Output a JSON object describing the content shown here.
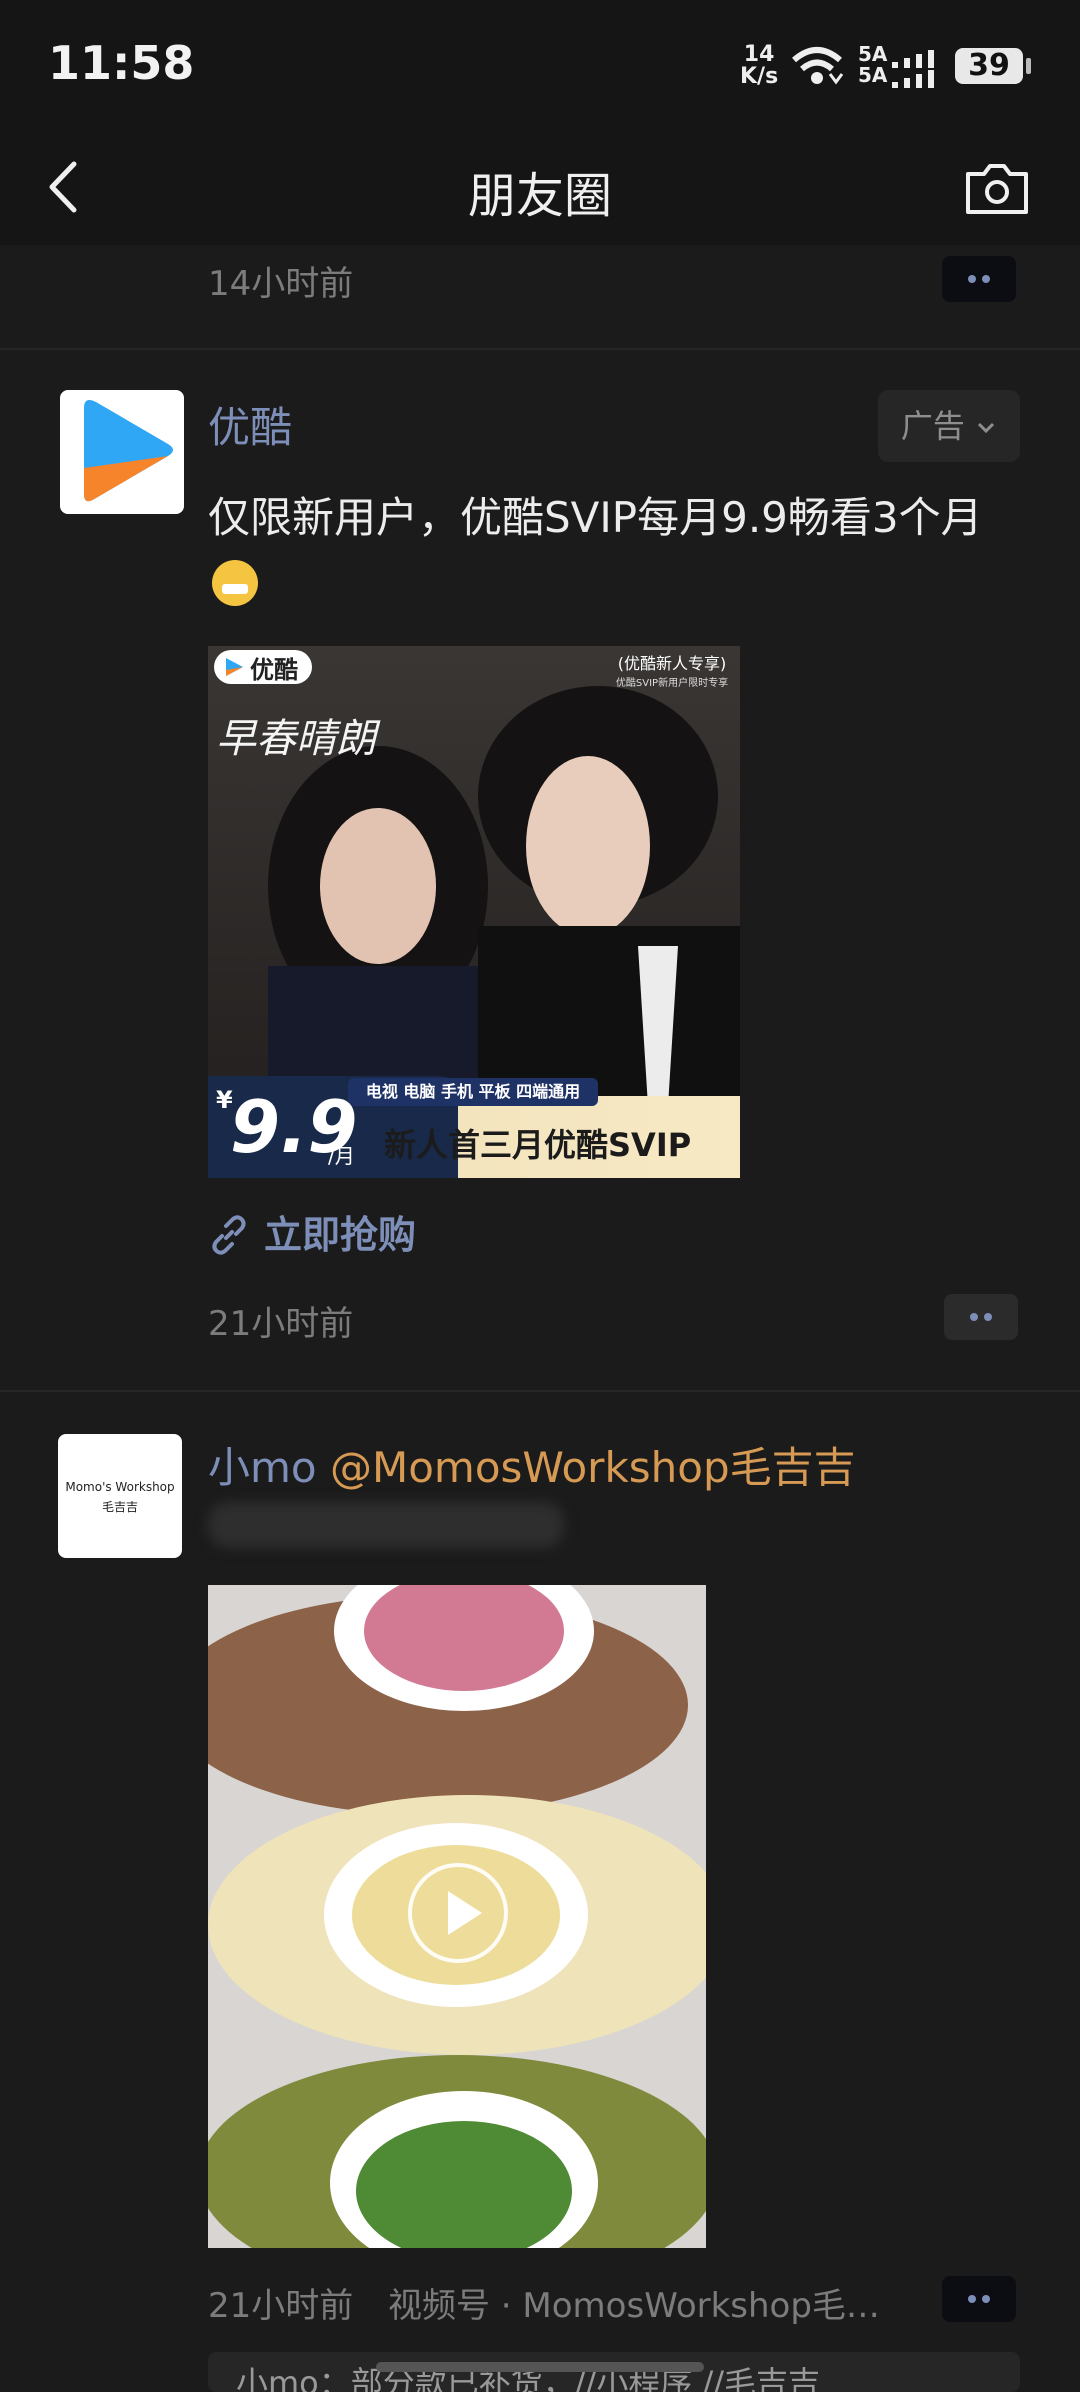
{
  "status_bar": {
    "time": "11:58",
    "net_speed_value": "14",
    "net_speed_unit": "K/s",
    "signal_1": "5A",
    "signal_2": "5A",
    "battery": "39"
  },
  "nav": {
    "title": "朋友圈"
  },
  "prev_post": {
    "timestamp": "14小时前"
  },
  "ad_post": {
    "author": "优酷",
    "ad_label": "广告",
    "text": "仅限新用户，优酷SVIP每月9.9畅看3个月",
    "image": {
      "brand": "优酷",
      "corner_title": "(优酷新人专享)",
      "corner_sub": "优酷SVIP新用户限时专享",
      "show_title": "早春晴朗",
      "currency": "¥",
      "price": "9.9",
      "price_unit": "/月",
      "devices": "电视 电脑 手机 平板 四端通用",
      "offer": "新人首三月优酷SVIP"
    },
    "link_label": "立即抢购",
    "timestamp": "21小时前"
  },
  "video_post": {
    "author": "小mo",
    "mention": "@MomosWorkshop毛吉吉",
    "avatar_line1": "Momo's Workshop",
    "avatar_line2": "毛吉吉",
    "timestamp": "21小时前",
    "source": "视频号 · MomosWorkshop毛…",
    "comment_preview": "小mo：部分款已补货，//小程序 //毛吉吉"
  },
  "colors": {
    "background": "#1b1b1b",
    "name_link": "#7d8fb8",
    "mention": "#d69a54",
    "youku_blue": "#2fa7f5",
    "youku_orange": "#f5842a"
  }
}
